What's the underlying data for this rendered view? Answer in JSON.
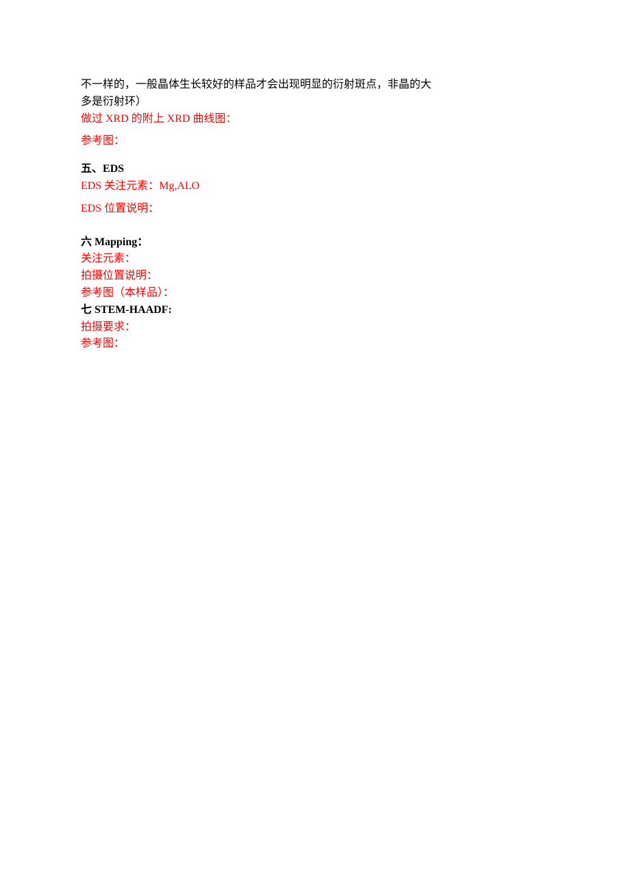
{
  "top": {
    "line1": "不一样的，一般晶体生长较好的样品才会出现明显的衍射斑点，非晶的大",
    "line2": "多是衍射环）",
    "xrd": "做过 XRD 的附上 XRD 曲线图：",
    "ref": "参考图："
  },
  "sec5": {
    "heading_prefix": "五、",
    "heading_title": "EDS",
    "elements": "EDS 关注元素：Mg,ALO",
    "position": "EDS 位置说明："
  },
  "sec6": {
    "heading_prefix": "六 ",
    "heading_title": "Mapping：",
    "elements": "关注元素：",
    "position": "拍摄位置说明：",
    "ref": "参考图（本样品）："
  },
  "sec7": {
    "heading_prefix": "七 ",
    "heading_title": "STEM-HAADF:",
    "requirements": "拍摄要求：",
    "ref": "参考图："
  }
}
